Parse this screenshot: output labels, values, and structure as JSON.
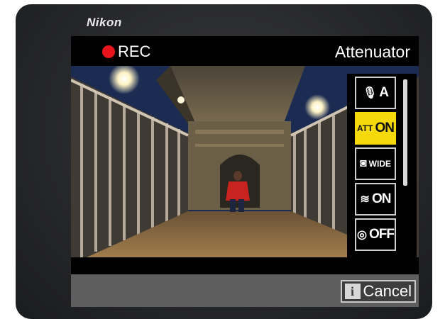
{
  "device": {
    "brand": "Nikon"
  },
  "screen": {
    "rec_label": "REC",
    "title": "Attenuator",
    "menu_items": [
      {
        "icon": "microphone-icon",
        "glyph": "🎙",
        "label": "A",
        "selected": false
      },
      {
        "icon": "attenuator-icon",
        "glyph": "ATT",
        "label": "ON",
        "selected": true
      },
      {
        "icon": "frequency-response-icon",
        "glyph": "◙",
        "label": "WIDE",
        "selected": false
      },
      {
        "icon": "wind-noise-icon",
        "glyph": "≋",
        "label": "ON",
        "selected": false
      },
      {
        "icon": "headphone-volume-icon",
        "glyph": "◎",
        "label": "OFF",
        "selected": false
      }
    ],
    "cancel_label": "Cancel",
    "info_glyph": "i"
  },
  "colors": {
    "rec": "#e8141c",
    "highlight": "#f5d90a",
    "bottom_bar": "#5e5e5e"
  }
}
